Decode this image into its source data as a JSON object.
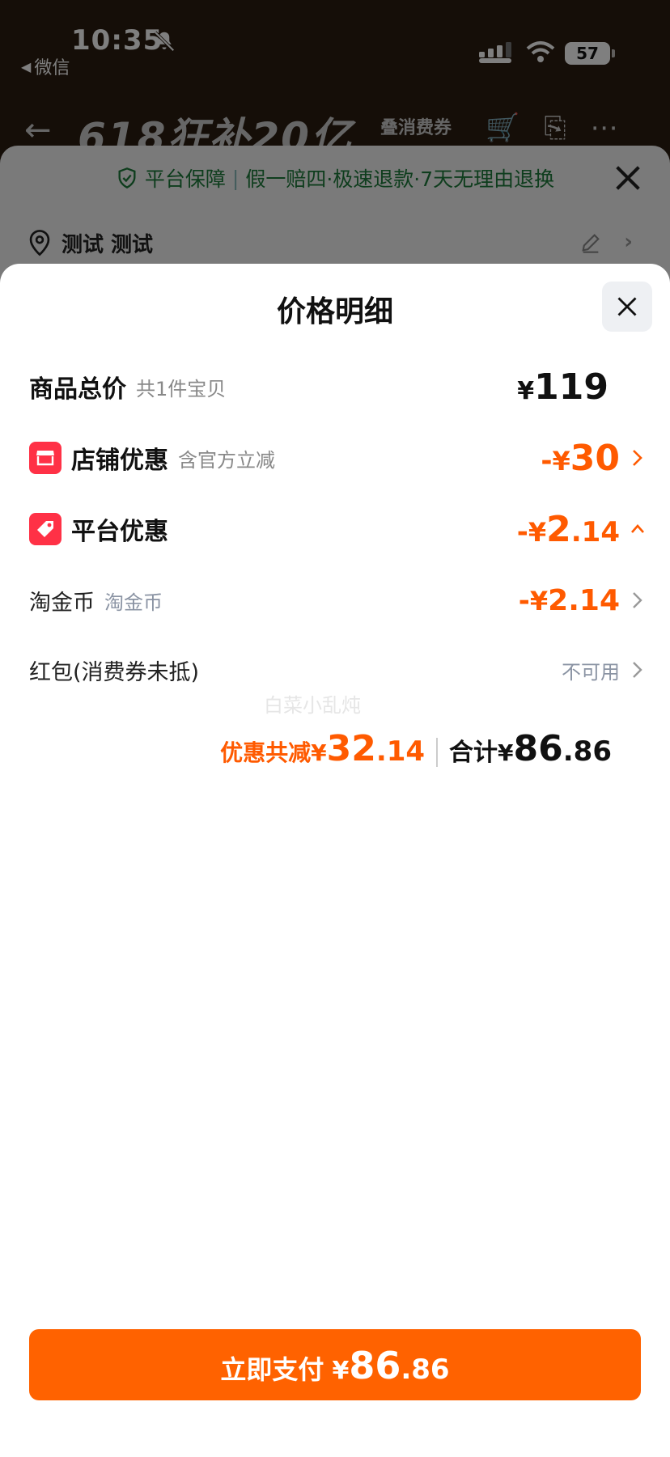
{
  "status_bar": {
    "time": "10:35",
    "back_app": "微信",
    "battery": "57"
  },
  "page_header": {
    "promo": "618狂补20亿",
    "sub": "叠消费券"
  },
  "guarantee": {
    "title": "平台保障",
    "detail": "假一赔四·极速退款·7天无理由退换"
  },
  "address": {
    "name": "测试 测试"
  },
  "price_sheet": {
    "title": "价格明细",
    "items": [
      {
        "label": "商品总价",
        "note": "共1件宝贝",
        "yen": "¥",
        "amount": "119"
      },
      {
        "label": "店铺优惠",
        "note": "含官方立减",
        "minus": "-",
        "yen": "¥",
        "amount": "30"
      },
      {
        "label": "平台优惠",
        "minus": "-",
        "yen": "¥",
        "amount_int": "2",
        "amount_dec": ".14"
      },
      {
        "label": "淘金币",
        "note": "淘金币",
        "minus": "-",
        "yen": "¥",
        "amount": "2.14"
      },
      {
        "label": "红包(消费券未抵)",
        "status": "不可用"
      }
    ],
    "watermark": "白菜小乱炖",
    "summary": {
      "saved_label": "优惠共减",
      "saved_yen": "¥",
      "saved_int": "32",
      "saved_dec": ".14",
      "total_label": "合计",
      "total_yen": "¥",
      "total_int": "86",
      "total_dec": ".86"
    },
    "pay_button": {
      "label": "立即支付",
      "yen": "¥",
      "int": "86",
      "dec": ".86"
    }
  },
  "colors": {
    "accent_orange": "#ff5a00",
    "pay_button": "#ff6200",
    "badge_red": "#ff3146",
    "guarantee_green": "#1c7a3a"
  }
}
